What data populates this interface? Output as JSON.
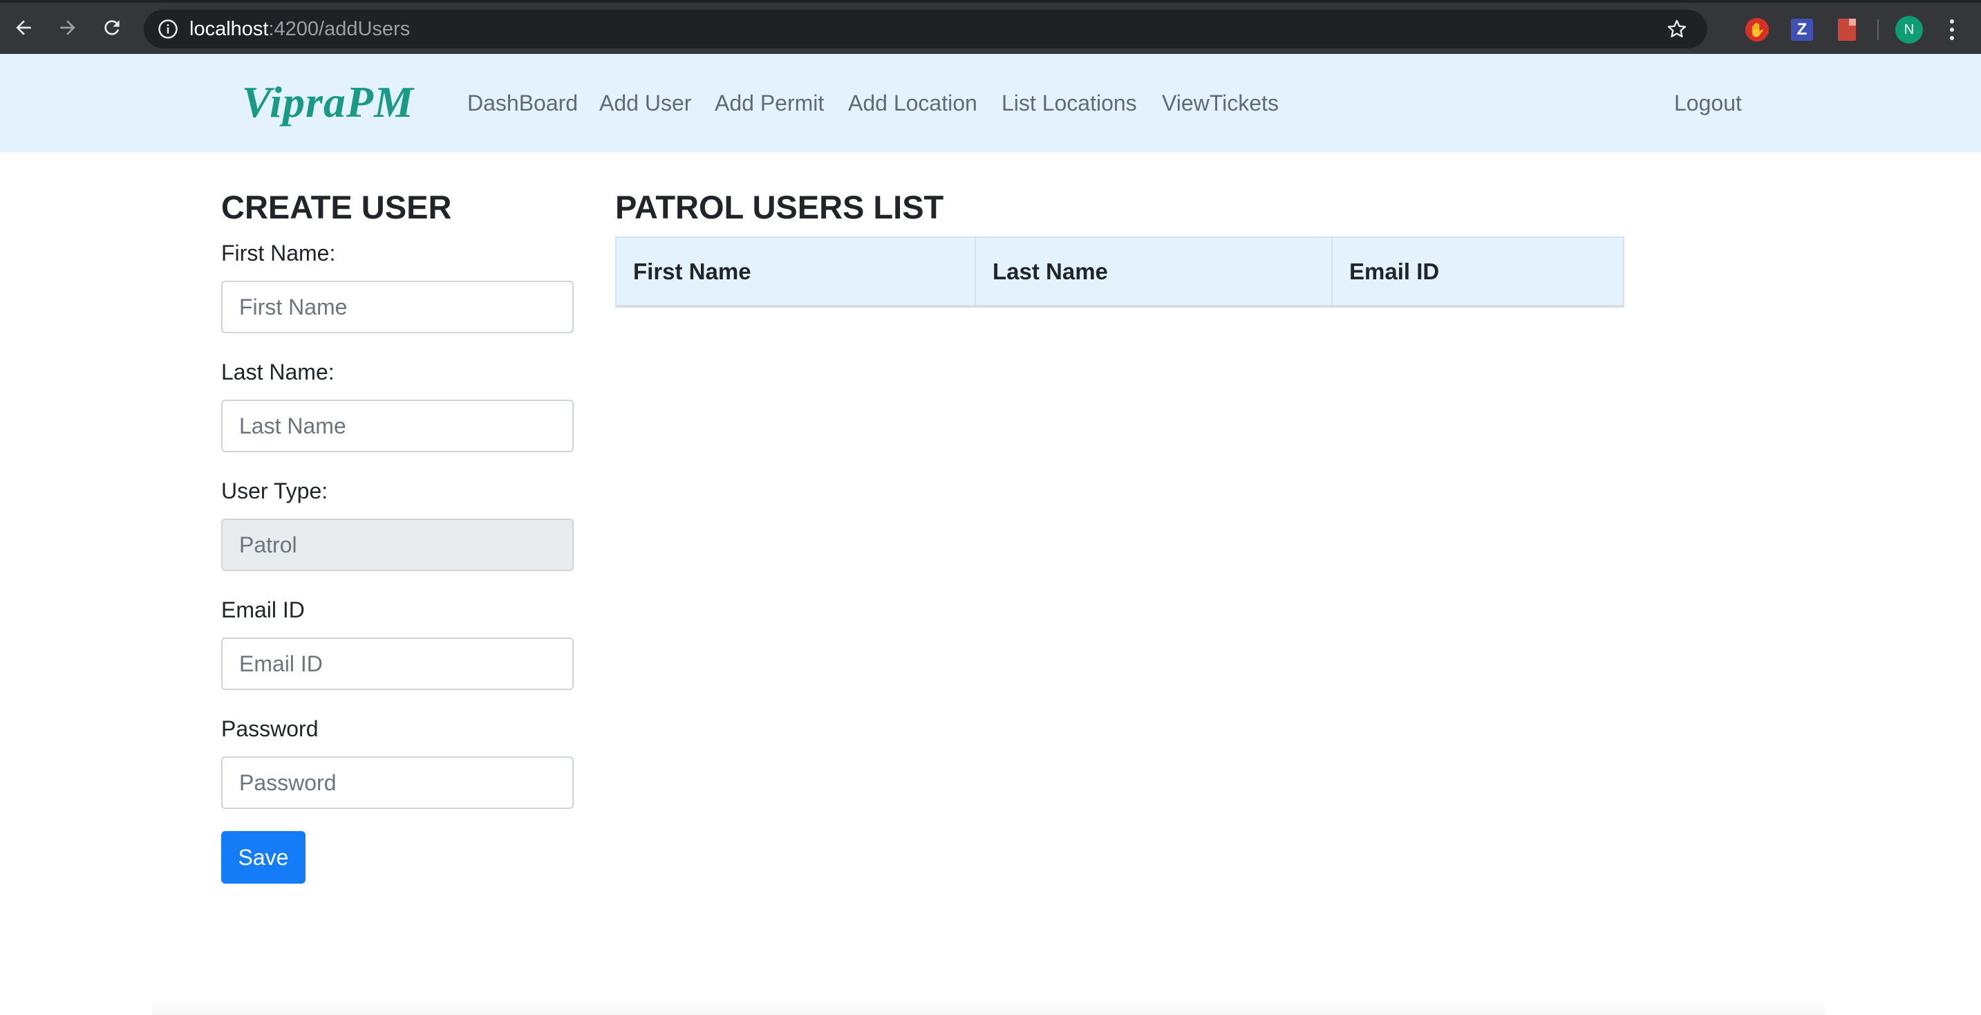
{
  "browser": {
    "url_host": "localhost",
    "url_rest": ":4200/addUsers",
    "profile_initial": "N",
    "extension_z_label": "Z"
  },
  "navbar": {
    "brand": "VipraPM",
    "links": {
      "dashboard": "DashBoard",
      "add_user": "Add User",
      "add_permit": "Add Permit",
      "add_location": "Add Location",
      "list_locations": "List Locations",
      "view_tickets": "ViewTickets"
    },
    "logout": "Logout"
  },
  "create_user": {
    "title": "CREATE USER",
    "first_name": {
      "label": "First Name:",
      "placeholder": "First Name",
      "value": ""
    },
    "last_name": {
      "label": "Last Name:",
      "placeholder": "Last Name",
      "value": ""
    },
    "user_type": {
      "label": "User Type:",
      "value": "Patrol"
    },
    "email": {
      "label": "Email ID",
      "placeholder": "Email ID",
      "value": ""
    },
    "password": {
      "label": "Password",
      "placeholder": "Password",
      "value": ""
    },
    "save_label": "Save"
  },
  "users_list": {
    "title": "PATROL USERS LIST",
    "columns": [
      "First Name",
      "Last Name",
      "Email ID"
    ],
    "rows": []
  },
  "colors": {
    "brand": "#1a9a86",
    "navbar_bg": "#e3f2fd",
    "primary_button": "#157cf7"
  }
}
